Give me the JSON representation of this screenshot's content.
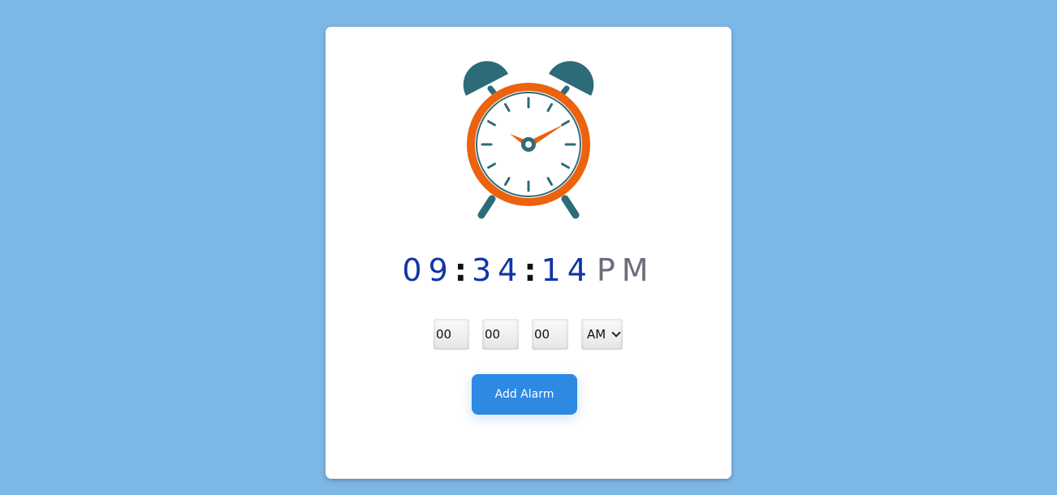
{
  "clock": {
    "hours": "09",
    "minutes": "34",
    "seconds": "14",
    "meridiem": "PM",
    "separator": ":"
  },
  "alarm_form": {
    "hour_value": "00",
    "minute_value": "00",
    "second_value": "00",
    "meridiem_selected": "AM",
    "add_button_label": "Add Alarm"
  },
  "colors": {
    "background": "#7db7e6",
    "clock_ring": "#eb620f",
    "clock_dark": "#2e6b78",
    "digits": "#1035a8",
    "meridiem": "#6b6e7a",
    "button": "#2e89e3"
  },
  "icons": {
    "alarm_clock": "alarm-clock-icon",
    "dropdown": "chevron-down-icon"
  }
}
